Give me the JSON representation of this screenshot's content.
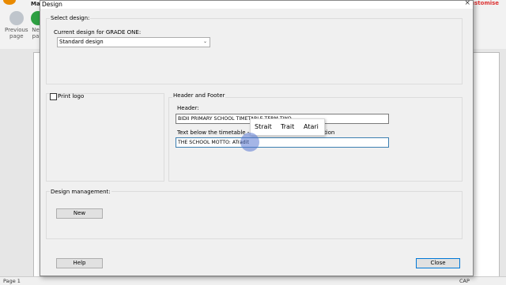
{
  "app": {
    "title_fragment": "Ma",
    "nav_previous": {
      "line1": "Previous",
      "line2": "page"
    },
    "nav_next": {
      "line1": "Ne",
      "line2": "pa"
    },
    "customise_fragment": "Customise",
    "status_page": "Page 1",
    "status_caps": "CAP"
  },
  "dialog": {
    "title": "Design",
    "select_design": {
      "group_label": "Select design:",
      "current_label": "Current design for GRADE ONE:",
      "current_value": "Standard design"
    },
    "print_logo_label": "Print logo",
    "header_footer": {
      "group_label": "Header and Footer",
      "header_label": "Header:",
      "header_value": "BIDII PRIMARY SCHOOL TIMETABLE TERM TWO",
      "text_below_label": "Text below the timetable - leave blank for no information",
      "text_below_value": "THE SCHOOL MOTTO: ATradit"
    },
    "design_management": {
      "group_label": "Design management:",
      "new_button": "New"
    },
    "help_button": "Help",
    "close_button": "Close"
  },
  "suggestions": [
    "Strait",
    "Trait",
    "Atari"
  ],
  "colors": {
    "dialog_bg": "#f0f0f0",
    "focus_border": "#3c7fb1",
    "default_button_border": "#0078d7"
  }
}
